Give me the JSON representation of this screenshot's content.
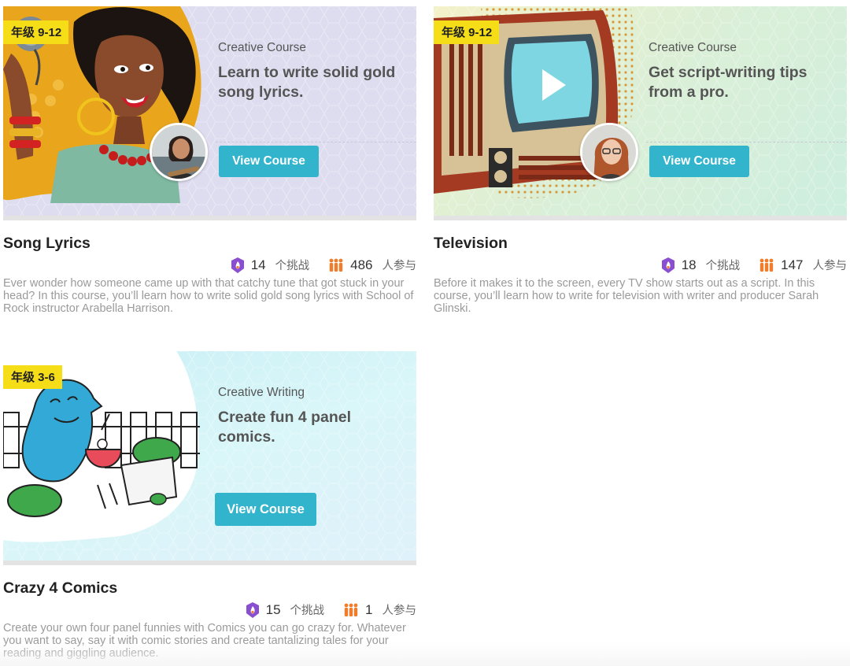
{
  "courses": [
    {
      "grade": "年级 9-12",
      "category": "Creative Course",
      "headline": "Learn to write solid gold song lyrics.",
      "button": "View Course",
      "title": "Song Lyrics",
      "challenges": "14",
      "challenges_unit": "个挑战",
      "participants": "486",
      "participants_unit": "人参与",
      "description": "Ever wonder how someone came up with that catchy tune that got stuck in your head? In this course, you’ll learn how to write solid gold song lyrics with School of Rock instructor Arabella Harrison."
    },
    {
      "grade": "年级 9-12",
      "category": "Creative Course",
      "headline": "Get script-writing tips from a pro.",
      "button": "View Course",
      "title": "Television",
      "challenges": "18",
      "challenges_unit": "个挑战",
      "participants": "147",
      "participants_unit": "人参与",
      "description": "Before it makes it to the screen, every TV show starts out as a script. In this course, you’ll learn how to write for television with writer and producer Sarah Glinski."
    },
    {
      "grade": "年级 3-6",
      "category": "Creative Writing",
      "headline": "Create fun 4 panel comics.",
      "button": "View Course",
      "title": "Crazy 4 Comics",
      "challenges": "15",
      "challenges_unit": "个挑战",
      "participants": "1",
      "participants_unit": "人参与",
      "description": "Create your own four panel funnies with Comics you can go crazy for. Whatever you want to say, say it with comic stories and create tantalizing tales for your reading and giggling audience."
    }
  ],
  "colors": {
    "accent_button": "#33b4cd",
    "grade_badge": "#f5dd18",
    "challenge_icon": "#8a4fd0",
    "people_icon": "#f07d2c"
  },
  "icons": {
    "challenge": "flame-badge-icon",
    "participants": "people-group-icon",
    "tv_play": "play-icon"
  }
}
